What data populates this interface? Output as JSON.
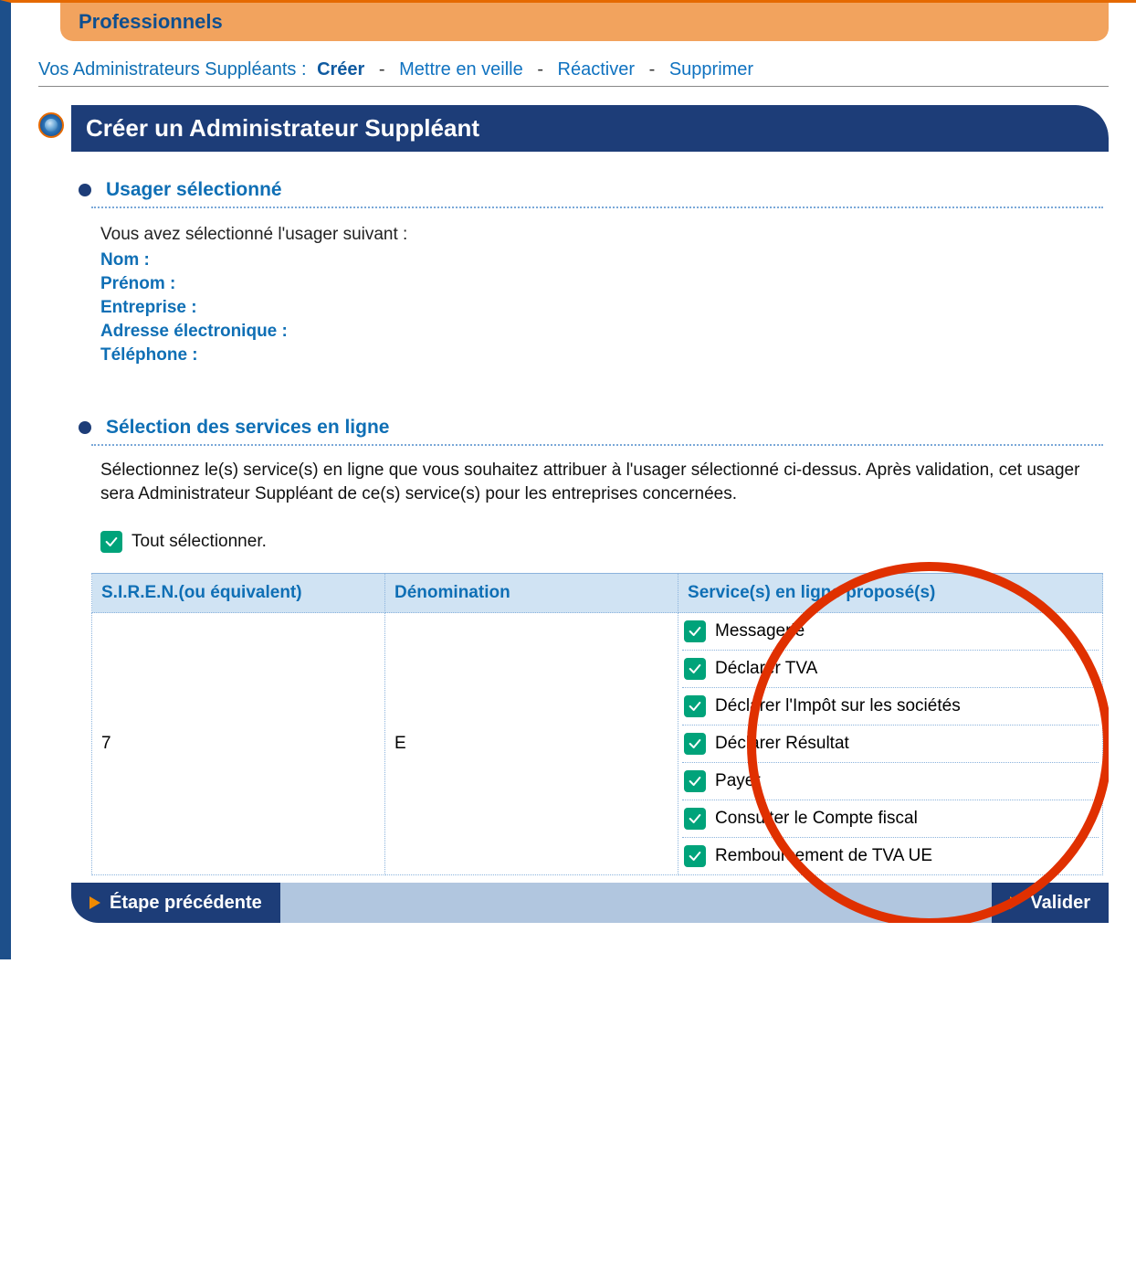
{
  "header": {
    "title": "Professionnels"
  },
  "subnav": {
    "label": "Vos Administrateurs Suppléants :",
    "items": [
      {
        "label": "Créer",
        "active": true
      },
      {
        "label": "Mettre en veille",
        "active": false
      },
      {
        "label": "Réactiver",
        "active": false
      },
      {
        "label": "Supprimer",
        "active": false
      }
    ]
  },
  "panel": {
    "title": "Créer un Administrateur Suppléant"
  },
  "section_user": {
    "heading": "Usager sélectionné",
    "lead": "Vous avez sélectionné l'usager suivant :",
    "fields": [
      "Nom :",
      "Prénom :",
      "Entreprise :",
      "Adresse électronique :",
      "Téléphone :"
    ]
  },
  "section_services": {
    "heading": "Sélection des services en ligne",
    "instructions": "Sélectionnez le(s) service(s) en ligne que vous souhaitez attribuer à l'usager sélectionné ci-dessus. Après validation, cet usager sera Administrateur Suppléant de ce(s) service(s) pour les entreprises concernées.",
    "select_all_label": "Tout sélectionner."
  },
  "table": {
    "headers": {
      "siren": "S.I.R.E.N.(ou équivalent)",
      "denom": "Dénomination",
      "services": "Service(s) en ligne proposé(s)"
    },
    "row": {
      "siren": "7",
      "denom": "E",
      "services": [
        "Messagerie",
        "Déclarer TVA",
        "Déclarer l'Impôt sur les sociétés",
        "Déclarer Résultat",
        "Payer",
        "Consulter le Compte fiscal",
        "Remboursement de TVA UE"
      ]
    }
  },
  "footer": {
    "prev": "Étape précédente",
    "validate": "Valider"
  }
}
